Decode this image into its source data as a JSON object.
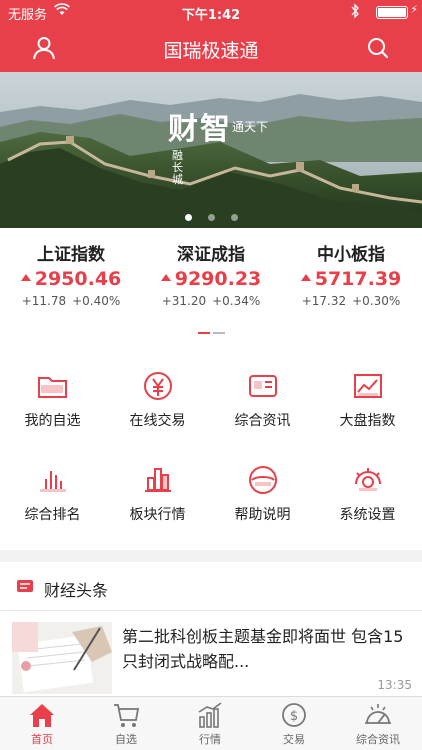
{
  "status_bar": {
    "carrier": "无服务",
    "time": "下午1:42"
  },
  "header": {
    "title": "国瑞极速通"
  },
  "banner": {
    "main_text": "财智",
    "text_a": "通天下",
    "text_b": "智",
    "text_c": "融长城",
    "slides": 3,
    "active_slide": 0
  },
  "indices": [
    {
      "name": "上证指数",
      "value": "2950.46",
      "change": "+11.78",
      "percent": "+0.40%"
    },
    {
      "name": "深证成指",
      "value": "9290.23",
      "change": "+31.20",
      "percent": "+0.34%"
    },
    {
      "name": "中小板指",
      "value": "5717.39",
      "change": "+17.32",
      "percent": "+0.30%"
    }
  ],
  "menu": [
    {
      "label": "我的自选",
      "icon": "folder-star-icon"
    },
    {
      "label": "在线交易",
      "icon": "yuan-circle-icon"
    },
    {
      "label": "综合资讯",
      "icon": "news-card-icon"
    },
    {
      "label": "大盘指数",
      "icon": "chart-line-icon"
    },
    {
      "label": "综合排名",
      "icon": "bar-ranking-icon"
    },
    {
      "label": "板块行情",
      "icon": "sector-bars-icon"
    },
    {
      "label": "帮助说明",
      "icon": "help-circle-icon"
    },
    {
      "label": "系统设置",
      "icon": "gear-icon"
    }
  ],
  "news": {
    "section_title": "财经头条",
    "items": [
      {
        "title": "第二批科创板主题基金即将面世 包含15只封闭式战略配...",
        "time": "13:35"
      }
    ]
  },
  "tabbar": [
    {
      "label": "首页",
      "icon": "home-icon",
      "active": true
    },
    {
      "label": "自选",
      "icon": "cart-icon",
      "active": false
    },
    {
      "label": "行情",
      "icon": "market-icon",
      "active": false
    },
    {
      "label": "交易",
      "icon": "dollar-circle-icon",
      "active": false
    },
    {
      "label": "综合资讯",
      "icon": "radar-icon",
      "active": false
    }
  ],
  "colors": {
    "brand_red": "#e8404a",
    "up_red": "#e8404a",
    "tab_inactive": "#666666"
  }
}
